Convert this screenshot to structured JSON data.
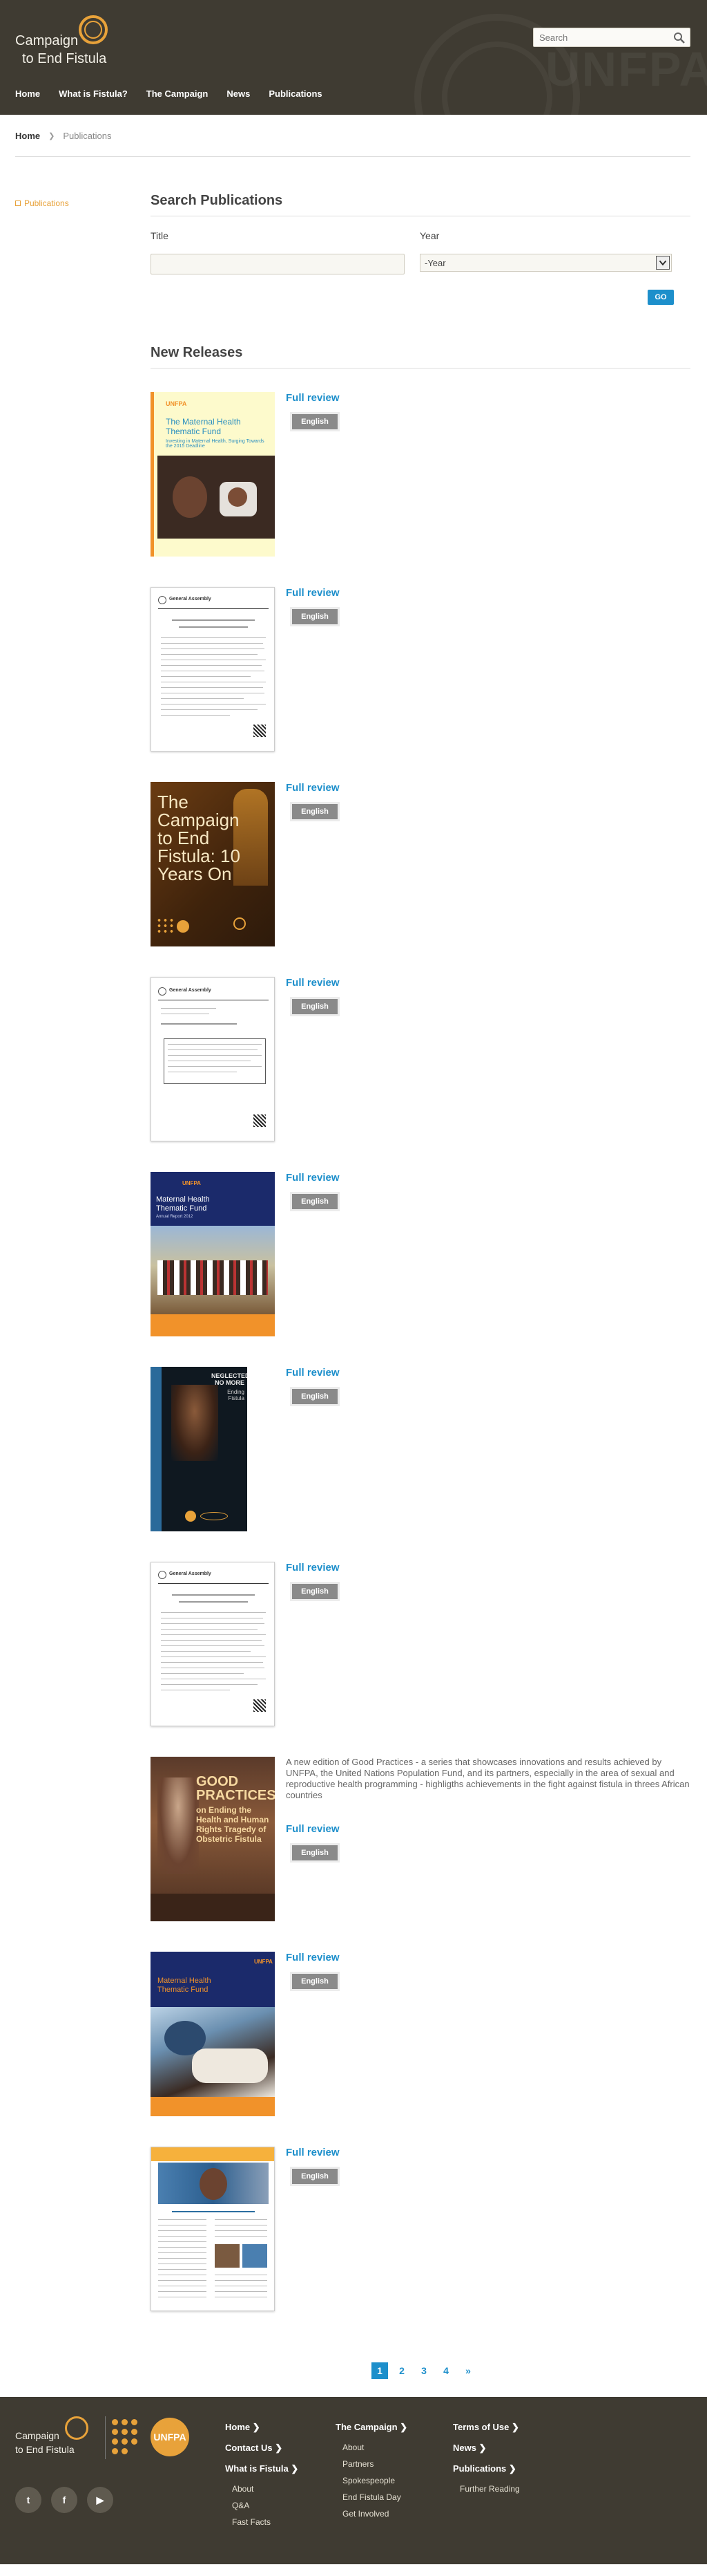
{
  "header": {
    "logo_line1": "Campaign",
    "logo_line2": "to End Fistula",
    "watermark": "UNFPA",
    "search_placeholder": "Search",
    "nav": [
      "Home",
      "What is Fistula?",
      "The Campaign",
      "News",
      "Publications"
    ]
  },
  "breadcrumb": {
    "home": "Home",
    "current": "Publications"
  },
  "sidebar": {
    "item": "Publications"
  },
  "search": {
    "heading": "Search Publications",
    "title_label": "Title",
    "year_label": "Year",
    "year_value": "-Year",
    "go_label": "GO"
  },
  "releases": {
    "heading": "New Releases",
    "full_review": "Full review",
    "english": "English",
    "good_practices_desc": "A new edition of Good Practices - a series that showcases innovations and results achieved by UNFPA, the United Nations Population Fund, and its partners, especially in the area of sexual and reproductive health programming - highligths achievements in the fight against fistula in threes African countries",
    "covers": {
      "mhtf1_title": "The Maternal Health Thematic Fund",
      "mhtf1_sub": "Investing in Maternal Health, Surging Towards the 2015 Deadline",
      "campaign_title": "The Campaign to End Fistula: 10 Years On",
      "mhtf2_title": "Maternal Health Thematic Fund",
      "mhtf2_sub": "Annual Report 2012",
      "neglected_title": "NEGLECTED NO MORE",
      "neglected_sub": "Ending Fistula",
      "good_practices_title": "GOOD PRACTICES",
      "good_practices_sub": "on Ending the Health and Human Rights Tragedy of Obstetric Fistula",
      "mhtf3_title": "Maternal Health Thematic Fund",
      "ga_label": "General Assembly",
      "unfpa_mark": "UNFPA"
    }
  },
  "pagination": {
    "pages": [
      "1",
      "2",
      "3",
      "4"
    ],
    "next": "»",
    "active": "1"
  },
  "footer": {
    "logo_line1": "Campaign",
    "logo_line2": "to End Fistula",
    "unfpa": "UNFPA",
    "social": [
      "t",
      "f",
      "▶"
    ],
    "col1": {
      "heads": [
        "Home",
        "Contact Us",
        "What is Fistula"
      ],
      "subs": [
        "About",
        "Q&A",
        "Fast Facts"
      ]
    },
    "col2": {
      "head": "The Campaign",
      "subs": [
        "About",
        "Partners",
        "Spokespeople",
        "End Fistula Day",
        "Get Involved"
      ]
    },
    "col3": {
      "heads": [
        "Terms of Use",
        "News",
        "Publications"
      ],
      "subs": [
        "Further Reading"
      ]
    }
  }
}
